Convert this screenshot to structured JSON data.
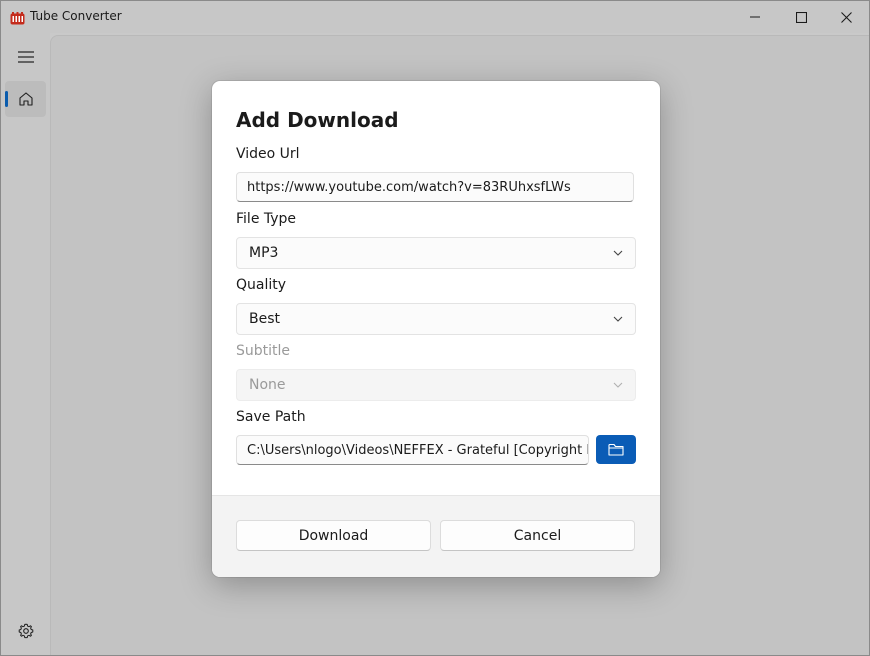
{
  "window": {
    "title": "Tube Converter",
    "accent_color": "#0b5cad"
  },
  "rail": {
    "items": [
      {
        "icon": "hamburger-menu-icon"
      },
      {
        "icon": "home-icon",
        "selected": true
      }
    ],
    "footer_icon": "settings-gear-icon"
  },
  "dialog": {
    "title": "Add Download",
    "video_url": {
      "label": "Video Url",
      "value": "https://www.youtube.com/watch?v=83RUhxsfLWs"
    },
    "file_type": {
      "label": "File Type",
      "value": "MP3"
    },
    "quality": {
      "label": "Quality",
      "value": "Best"
    },
    "subtitle": {
      "label": "Subtitle",
      "value": "None",
      "disabled": true
    },
    "save_path": {
      "label": "Save Path",
      "value": "C:\\Users\\nlogo\\Videos\\NEFFEX - Grateful [Copyright Fr"
    },
    "buttons": {
      "download": "Download",
      "cancel": "Cancel"
    }
  }
}
